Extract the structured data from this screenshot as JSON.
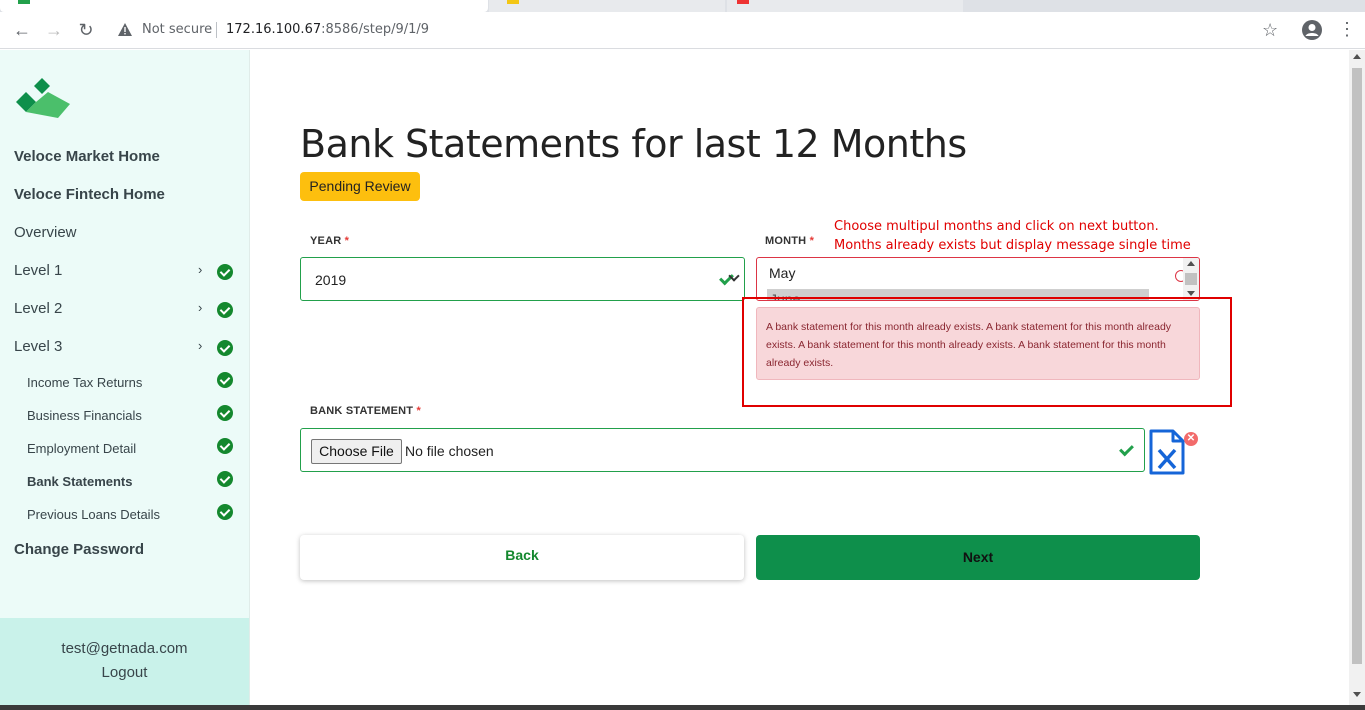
{
  "browser": {
    "security_label": "Not secure",
    "url_host": "172.16.100.67",
    "url_rest": ":8586/step/9/1/9"
  },
  "sidebar": {
    "main_links": [
      "Veloce Market Home",
      "Veloce Fintech Home"
    ],
    "overview": "Overview",
    "levels": [
      "Level 1",
      "Level 2",
      "Level 3"
    ],
    "sub_items": [
      "Income Tax Returns",
      "Business Financials",
      "Employment Detail",
      "Bank Statements",
      "Previous Loans Details"
    ],
    "change_password": "Change Password",
    "user_email": "test@getnada.com",
    "logout": "Logout"
  },
  "main": {
    "title": "Bank Statements for last 12 Months",
    "status_badge": "Pending Review",
    "year_label": "YEAR",
    "year_value": "2019",
    "month_label": "MONTH",
    "month_options": [
      "May",
      "June"
    ],
    "required_marker": "*",
    "annotation_line1": "Choose multipul months and click on next button.",
    "annotation_line2": "Months already exists but display message single time",
    "error_message": "A bank statement for this month already exists. A bank statement for this month already exists. A bank statement for this month already exists. A bank statement for this month already exists.",
    "bank_statement_label": "BANK STATEMENT",
    "choose_file": "Choose File",
    "no_file": "No file chosen",
    "back": "Back",
    "next": "Next"
  },
  "colors": {
    "accent_green": "#14882e",
    "badge": "#fdbf0e",
    "error": "#dc3545"
  }
}
